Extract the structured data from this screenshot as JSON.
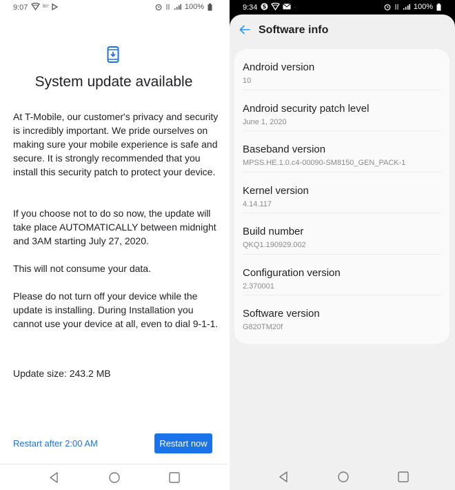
{
  "left": {
    "status_bar": {
      "time": "9:07",
      "temp": "90°",
      "battery": "100%",
      "icons": [
        "wifi-shield-icon",
        "play-icon",
        "alarm-icon",
        "data-icon",
        "signal-icon",
        "battery-icon"
      ]
    },
    "title": "System update available",
    "paragraphs": [
      "At T-Mobile, our customer's privacy and security is incredibly important. We pride ourselves on making sure your mobile experience is safe and secure. It is strongly recommended that you install this security patch to protect your device.",
      "If you choose not to do so now, the update will take place AUTOMATICALLY between midnight and 3AM starting July 27, 2020.",
      "This will not consume your data.",
      "Please do not turn off your device while the update is installing. During Installation you cannot use your device at all, even to dial 9-1-1."
    ],
    "update_size": "Update size: 243.2 MB",
    "restart_later_label": "Restart after 2:00 AM",
    "restart_now_label": "Restart now",
    "accent_color": "#1a73e8"
  },
  "right": {
    "status_bar": {
      "time": "9:34",
      "battery": "100%",
      "icons": [
        "s-icon",
        "wifi-shield-icon",
        "mail-icon",
        "alarm-icon",
        "data-icon",
        "signal-icon",
        "battery-icon"
      ]
    },
    "title": "Software info",
    "items": [
      {
        "label": "Android version",
        "value": "10"
      },
      {
        "label": "Android security patch level",
        "value": "June 1, 2020"
      },
      {
        "label": "Baseband version",
        "value": "MPSS.HE.1.0.c4-00090-SM8150_GEN_PACK-1"
      },
      {
        "label": "Kernel version",
        "value": "4.14.117"
      },
      {
        "label": "Build number",
        "value": "QKQ1.190929.002"
      },
      {
        "label": "Configuration version",
        "value": "2.370001"
      },
      {
        "label": "Software version",
        "value": "G820TM20f"
      }
    ],
    "accent_color": "#2196f3"
  }
}
